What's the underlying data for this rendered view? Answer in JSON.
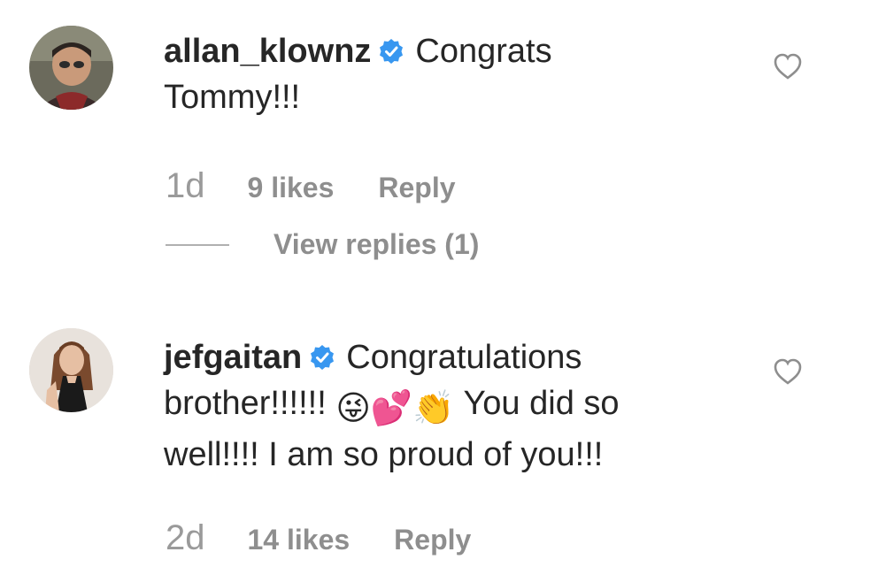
{
  "comments": [
    {
      "username": "allan_klownz",
      "verified": true,
      "text_line_1": "Congrats",
      "text_line_2": "Tommy!!!",
      "timestamp": "1d",
      "likes": "9 likes",
      "reply_label": "Reply",
      "view_replies": "View replies (1)",
      "avatar_icon": "avatar-photo-man"
    },
    {
      "username": "jefgaitan",
      "verified": true,
      "text_part_1": "Congratulations",
      "text_part_2": "brother!!!!!!",
      "emojis": "😜💕👏",
      "text_part_3": "You did so",
      "text_part_4": "well!!!! I am so proud of you!!!",
      "timestamp": "2d",
      "likes": "14 likes",
      "reply_label": "Reply",
      "avatar_icon": "avatar-photo-woman"
    }
  ],
  "colors": {
    "verified_blue": "#3897f0",
    "text": "#262626",
    "secondary": "#8e8e8e"
  }
}
